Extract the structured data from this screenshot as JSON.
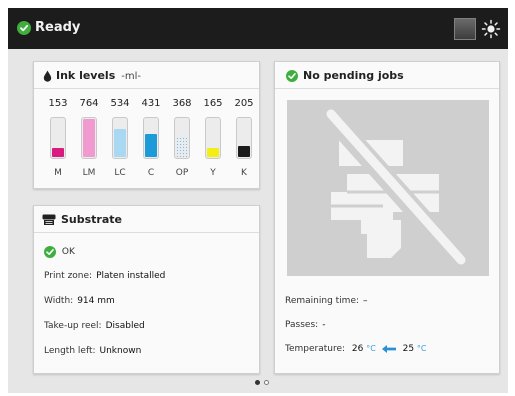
{
  "status": {
    "text": "Ready",
    "icon": "checkmark-circle-icon",
    "color": "#3fae3f"
  },
  "topbar": {
    "square_button_icon": "square-icon",
    "brightness_icon": "sun-icon"
  },
  "ink_panel": {
    "title": "Ink levels",
    "unit": "-ml-",
    "icon": "ink-drop-icon",
    "cartridges": [
      {
        "label": "M",
        "value": "153",
        "level": 0.22,
        "color": "#d81b7e"
      },
      {
        "label": "LM",
        "value": "764",
        "level": 0.95,
        "color": "#f19ad0"
      },
      {
        "label": "LC",
        "value": "534",
        "level": 0.7,
        "color": "#a8d8f2"
      },
      {
        "label": "C",
        "value": "431",
        "level": 0.58,
        "color": "#1d9ad8"
      },
      {
        "label": "OP",
        "value": "368",
        "level": 0.5,
        "color": "#e6eef3",
        "dotted": true
      },
      {
        "label": "Y",
        "value": "165",
        "level": 0.22,
        "color": "#f2ee16"
      },
      {
        "label": "K",
        "value": "205",
        "level": 0.28,
        "color": "#1b1b1b"
      }
    ]
  },
  "substrate_panel": {
    "title": "Substrate",
    "icon": "substrate-roll-icon",
    "status_icon": "checkmark-circle-icon",
    "status": "OK",
    "print_zone_label": "Print zone:",
    "print_zone_value": "Platen installed",
    "width_label": "Width:",
    "width_value": "914 mm",
    "takeup_label": "Take-up reel:",
    "takeup_value": "Disabled",
    "length_label": "Length left:",
    "length_value": "Unknown"
  },
  "jobs_panel": {
    "title": "No pending jobs",
    "icon": "checkmark-circle-icon",
    "image_icon": "no-jobs-printer-icon",
    "remaining_label": "Remaining time:",
    "remaining_value": "–",
    "passes_label": "Passes:",
    "passes_value": "-",
    "temperature_label": "Temperature:",
    "temp1": "26",
    "temp2": "25",
    "temp_unit": "°C",
    "temp_icon_1": "thermometer-icon",
    "temp_icon_2": "airflow-arrow-icon"
  },
  "pagination": {
    "pages": 2,
    "current": 1
  }
}
